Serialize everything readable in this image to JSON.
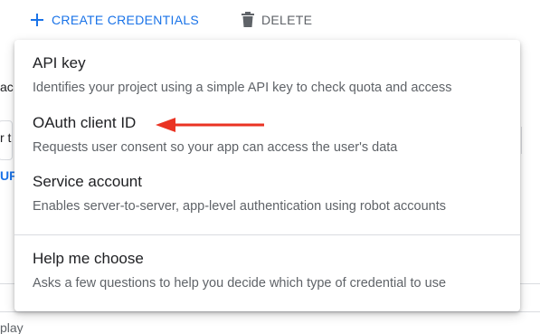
{
  "toolbar": {
    "create_label": "CREATE CREDENTIALS",
    "delete_label": "DELETE"
  },
  "background": {
    "frag_1": "ac",
    "frag_2": "r t",
    "frag_3": "UP",
    "frag_4": "play"
  },
  "menu": {
    "items": [
      {
        "title": "API key",
        "description": "Identifies your project using a simple API key to check quota and access"
      },
      {
        "title": "OAuth client ID",
        "description": "Requests user consent so your app can access the user's data"
      },
      {
        "title": "Service account",
        "description": "Enables server-to-server, app-level authentication using robot accounts"
      },
      {
        "title": "Help me choose",
        "description": "Asks a few questions to help you decide which type of credential to use"
      }
    ]
  },
  "colors": {
    "accent": "#1a73e8",
    "text_primary": "#202124",
    "text_secondary": "#5f6368",
    "annotation_arrow": "#ea3323"
  },
  "icons": {
    "create": "plus-icon",
    "delete": "trash-icon",
    "annotation": "red-arrow-icon"
  }
}
